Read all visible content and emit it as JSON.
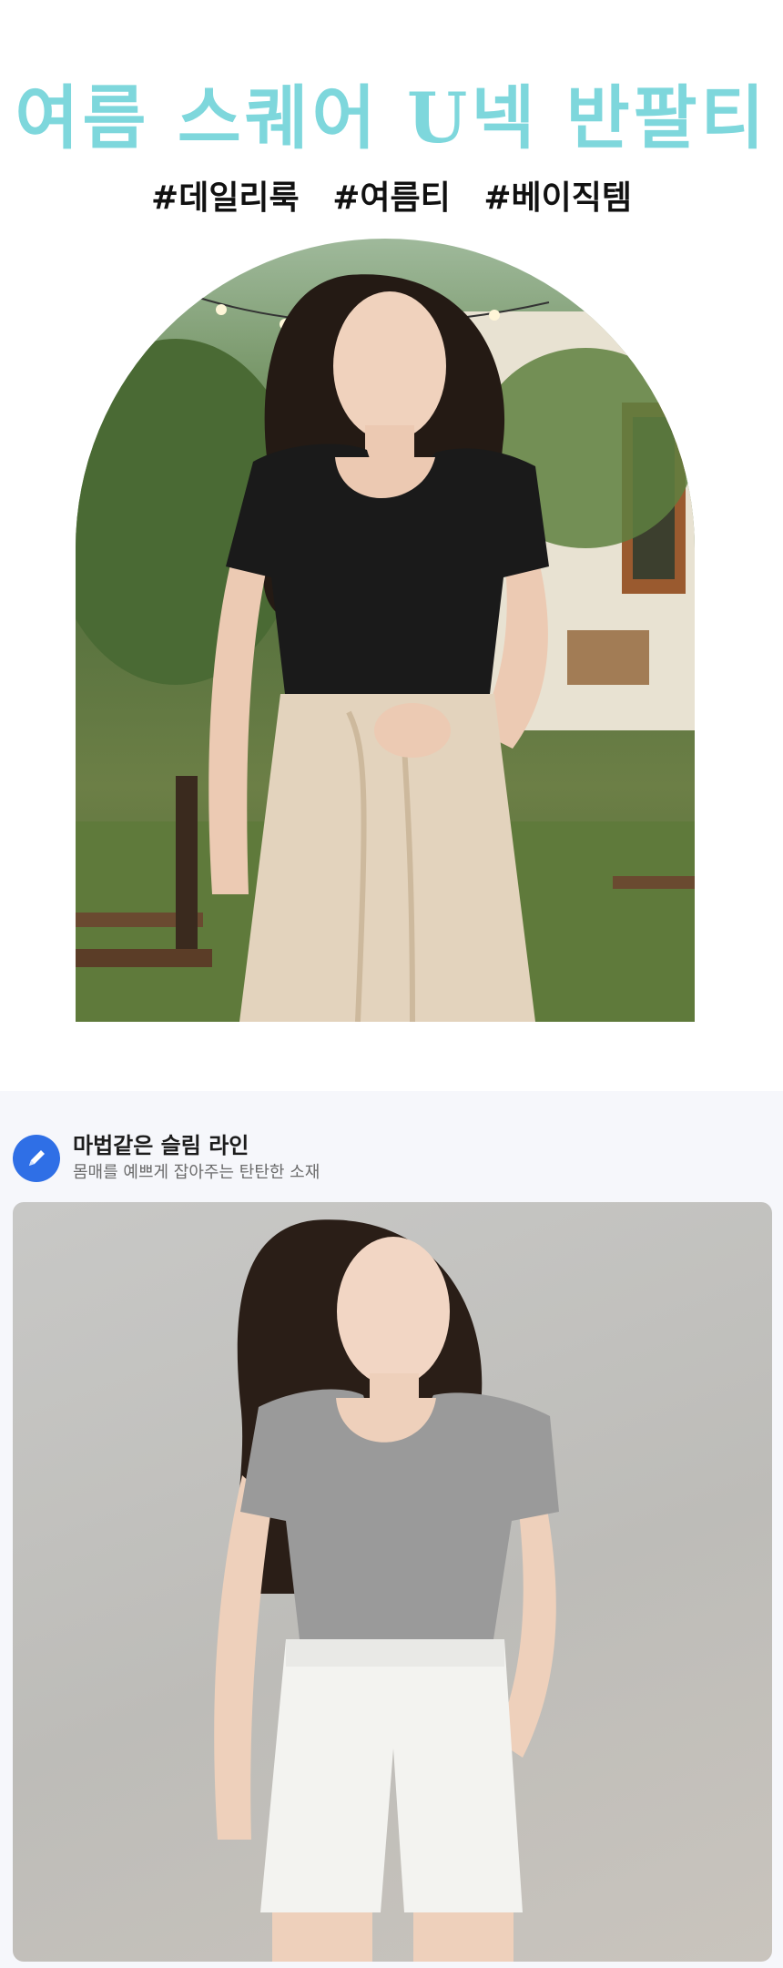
{
  "hero": {
    "title": "여름 스퀘어 U넥 반팔티",
    "hashtags": [
      "#데일리룩",
      "#여름티",
      "#베이직템"
    ]
  },
  "feature": {
    "title": "마법같은 슬림 라인",
    "subtitle": "몸매를 예쁘게 잡아주는 탄탄한 소재"
  },
  "colors": {
    "title_accent": "#7ed7dc",
    "badge": "#2f6fe6",
    "tee_black": "#1a1a1a",
    "tee_gray": "#9a9a9a"
  },
  "icons": {
    "feature_badge": "pencil-icon"
  }
}
